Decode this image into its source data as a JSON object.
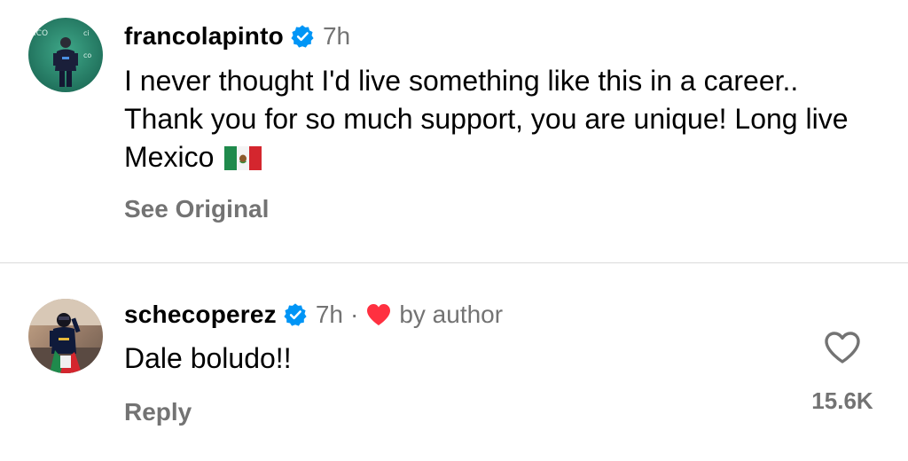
{
  "comments": [
    {
      "username": "francolapinto",
      "verified": true,
      "timestamp": "7h",
      "text": "I never thought I'd live something like this in a career.. Thank you for so much support, you are unique! Long live Mexico",
      "emoji": "mexico-flag",
      "action": "See Original"
    },
    {
      "username": "schecoperez",
      "verified": true,
      "timestamp": "7h",
      "separator": "·",
      "liked_by_author_label": "by author",
      "text": "Dale boludo!!",
      "action": "Reply",
      "like_count": "15.6K"
    }
  ],
  "colors": {
    "verified_blue": "#0095f6",
    "heart_red": "#ff3040",
    "secondary_text": "#737373",
    "divider": "#dbdbdb"
  }
}
